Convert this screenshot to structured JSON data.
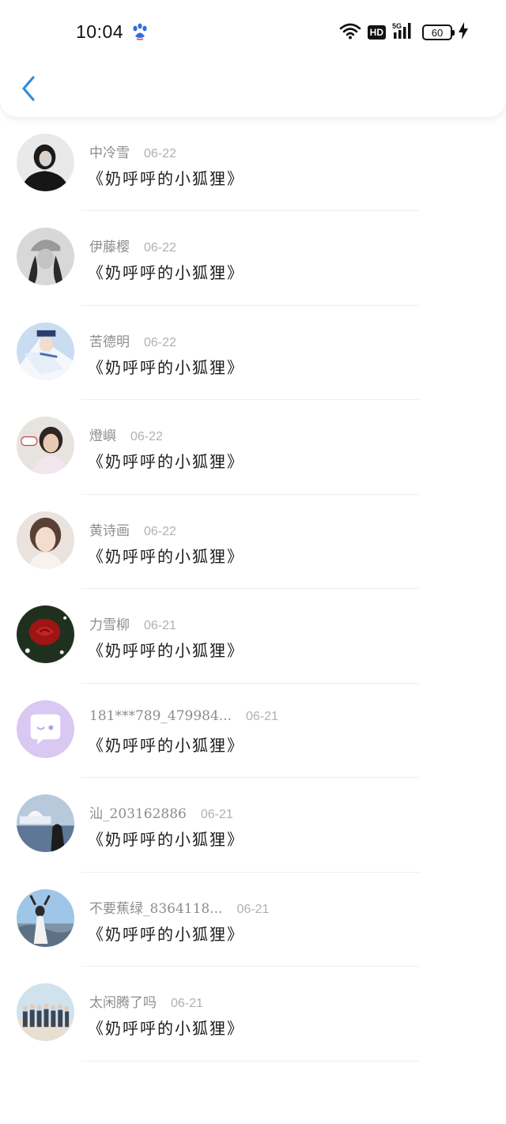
{
  "status_bar": {
    "time": "10:04",
    "hd_label": "HD",
    "network_label": "5G",
    "battery_level": "60"
  },
  "header": {
    "back_icon": "chevron-left-icon",
    "accent_color": "#2d8fe0"
  },
  "items": [
    {
      "name": "",
      "date": "",
      "message": "《奶呼呼的小狐狸》",
      "avatar": "default-chat-bubble"
    },
    {
      "name": "中冷雪",
      "date": "06-22",
      "message": "《奶呼呼的小狐狸》",
      "avatar": "photo-dark"
    },
    {
      "name": "伊藤樱",
      "date": "06-22",
      "message": "《奶呼呼的小狐狸》",
      "avatar": "photo-cap"
    },
    {
      "name": "苦德明",
      "date": "06-22",
      "message": "《奶呼呼的小狐狸》",
      "avatar": "photo-anime"
    },
    {
      "name": "燈嶼",
      "date": "06-22",
      "message": "《奶呼呼的小狐狸》",
      "avatar": "photo-girl"
    },
    {
      "name": "黄诗画",
      "date": "06-22",
      "message": "《奶呼呼的小狐狸》",
      "avatar": "photo-face"
    },
    {
      "name": "力雪柳",
      "date": "06-21",
      "message": "《奶呼呼的小狐狸》",
      "avatar": "photo-rose"
    },
    {
      "name": "181***789_479984...",
      "date": "06-21",
      "message": "《奶呼呼的小狐狸》",
      "avatar": "default-chat-bubble"
    },
    {
      "name": "汕_203162886",
      "date": "06-21",
      "message": "《奶呼呼的小狐狸》",
      "avatar": "photo-sea"
    },
    {
      "name": "不要蕉绿_8364118...",
      "date": "06-21",
      "message": "《奶呼呼的小狐狸》",
      "avatar": "photo-sky"
    },
    {
      "name": "太闲腾了吗",
      "date": "06-21",
      "message": "《奶呼呼的小狐狸》",
      "avatar": "photo-group"
    }
  ]
}
